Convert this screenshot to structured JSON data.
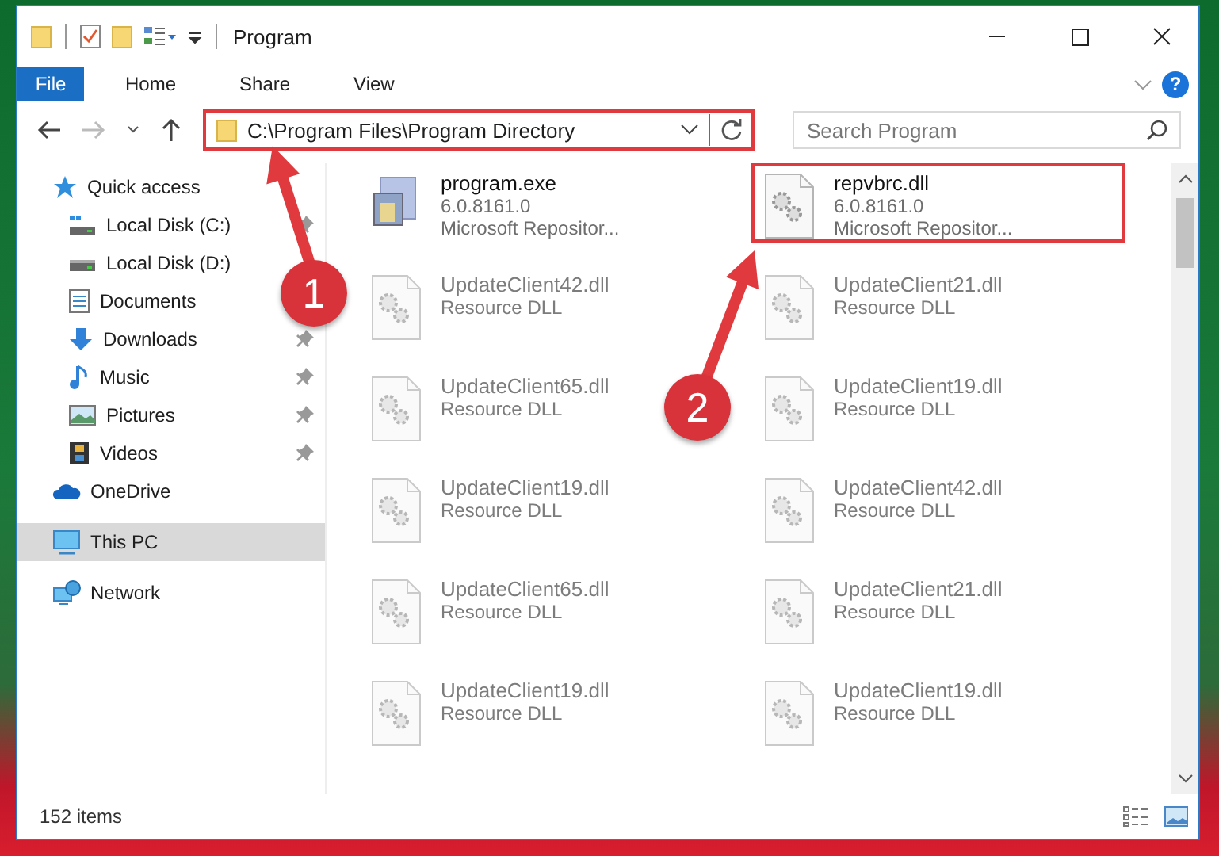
{
  "window": {
    "title": "Program"
  },
  "ribbon_tabs": [
    {
      "label": "File",
      "selected": true
    },
    {
      "label": "Home",
      "selected": false
    },
    {
      "label": "Share",
      "selected": false
    },
    {
      "label": "View",
      "selected": false
    }
  ],
  "address_bar": {
    "path": "C:\\Program Files\\Program Directory",
    "highlighted": true
  },
  "search": {
    "placeholder": "Search Program"
  },
  "help_button": {
    "label": "?"
  },
  "sidebar": {
    "items": [
      {
        "label": "Quick access",
        "kind": "star",
        "selected": false,
        "children": [
          {
            "label": "Local Disk (C:)",
            "kind": "drive-c",
            "pinned": true,
            "selected": false
          },
          {
            "label": "Local Disk (D:)",
            "kind": "drive",
            "pinned": false,
            "selected": false
          },
          {
            "label": "Documents",
            "kind": "documents",
            "pinned": false,
            "selected": false
          },
          {
            "label": "Downloads",
            "kind": "downloads",
            "pinned": true,
            "selected": false
          },
          {
            "label": "Music",
            "kind": "music",
            "pinned": true,
            "selected": false
          },
          {
            "label": "Pictures",
            "kind": "pictures",
            "pinned": true,
            "selected": false
          },
          {
            "label": "Videos",
            "kind": "videos",
            "pinned": true,
            "selected": false
          }
        ]
      },
      {
        "label": "OneDrive",
        "kind": "cloud",
        "selected": false
      },
      {
        "label": "This PC",
        "kind": "pc",
        "selected": true
      },
      {
        "label": "Network",
        "kind": "network",
        "selected": false
      }
    ]
  },
  "files": [
    {
      "name": "program.exe",
      "details": [
        "6.0.8161.0",
        "Microsoft Repositor..."
      ],
      "kind": "exe",
      "highlighted": false
    },
    {
      "name": "repvbrc.dll",
      "details": [
        "6.0.8161.0",
        "Microsoft Repositor..."
      ],
      "kind": "dll",
      "highlighted": true
    },
    {
      "name": "UpdateClient42.dll",
      "details": [
        "Resource DLL"
      ],
      "kind": "dll",
      "highlighted": false
    },
    {
      "name": "UpdateClient21.dll",
      "details": [
        "Resource DLL"
      ],
      "kind": "dll",
      "highlighted": false
    },
    {
      "name": "UpdateClient65.dll",
      "details": [
        "Resource DLL"
      ],
      "kind": "dll",
      "highlighted": false
    },
    {
      "name": "UpdateClient19.dll",
      "details": [
        "Resource DLL"
      ],
      "kind": "dll",
      "highlighted": false
    },
    {
      "name": "UpdateClient19.dll",
      "details": [
        "Resource DLL"
      ],
      "kind": "dll",
      "highlighted": false
    },
    {
      "name": "UpdateClient42.dll",
      "details": [
        "Resource DLL"
      ],
      "kind": "dll",
      "highlighted": false
    },
    {
      "name": "UpdateClient65.dll",
      "details": [
        "Resource DLL"
      ],
      "kind": "dll",
      "highlighted": false
    },
    {
      "name": "UpdateClient21.dll",
      "details": [
        "Resource DLL"
      ],
      "kind": "dll",
      "highlighted": false
    },
    {
      "name": "UpdateClient19.dll",
      "details": [
        "Resource DLL"
      ],
      "kind": "dll",
      "highlighted": false
    },
    {
      "name": "UpdateClient19.dll",
      "details": [
        "Resource DLL"
      ],
      "kind": "dll",
      "highlighted": false
    }
  ],
  "status_bar": {
    "item_count": "152 items"
  },
  "annotations": [
    {
      "number": "1"
    },
    {
      "number": "2"
    }
  ]
}
